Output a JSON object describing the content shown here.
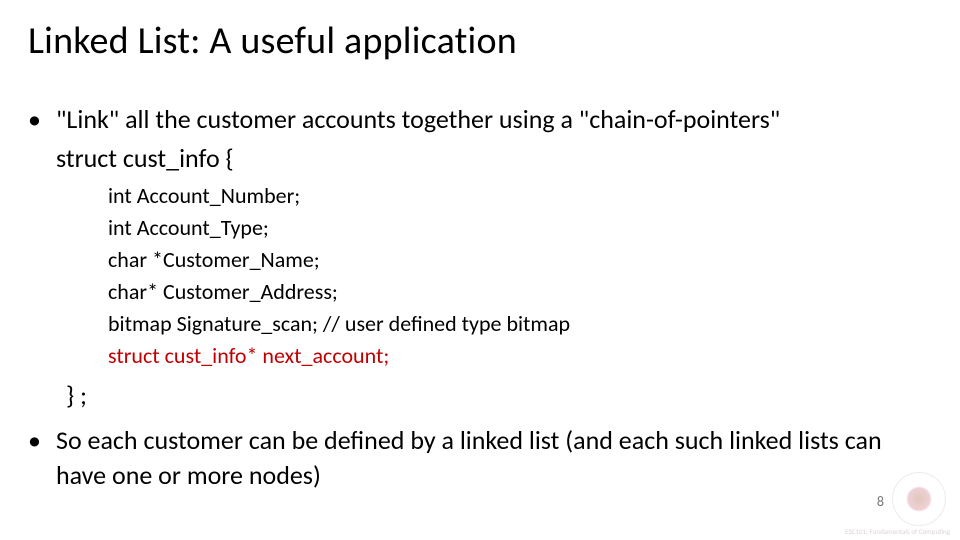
{
  "title": "Linked List: A useful application",
  "bullet1": "\"Link\" all the customer accounts together using a \"chain-of-pointers\"",
  "struct_open": "struct cust_info {",
  "struct_lines": [
    {
      "text": "int Account_Number;",
      "highlight": false
    },
    {
      "text": "int Account_Type;",
      "highlight": false
    },
    {
      "text": "char *Customer_Name;",
      "highlight": false
    },
    {
      "text": "char* Customer_Address;",
      "highlight": false
    },
    {
      "text": "bitmap Signature_scan; // user defined type bitmap",
      "highlight": false
    },
    {
      "text": "struct cust_info* next_account;",
      "highlight": true
    }
  ],
  "struct_close": "} ;",
  "bullet2": "So each customer can be defined by a linked list (and each such linked lists can have  one or more nodes)",
  "page_number": "8",
  "watermark_caption": "ESC101: Fundamentals\nof Computing"
}
